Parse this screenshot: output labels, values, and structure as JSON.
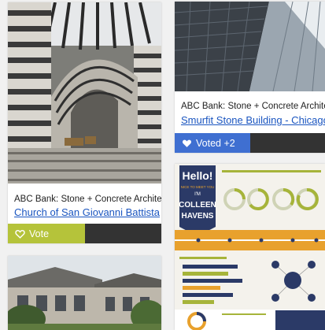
{
  "cards": [
    {
      "source": "ABC Bank: Stone + Concrete Architecture",
      "title": "Church of San Giovanni Battista",
      "vote_label": "Vote",
      "vote_color": "#b5c33a"
    },
    {
      "source": "ABC Bank: Stone + Concrete Architecture",
      "title": "Smurfit Stone Building - Chicago",
      "vote_label": "Voted +2",
      "vote_color": "#3f6fd1"
    },
    {
      "infographic": {
        "hello": "Hello!",
        "subtitle": "NICE TO MEET YOU",
        "im": "I'M",
        "first_name": "COLLEEN",
        "last_name": "HAVENS"
      }
    },
    {}
  ],
  "colors": {
    "accent_navy": "#2b3a67",
    "accent_orange": "#e8a12d",
    "accent_olive": "#a6b43a",
    "link": "#1a55c0"
  },
  "icons": {
    "vote": "heart-outline-icon",
    "voted": "heart-filled-icon"
  }
}
